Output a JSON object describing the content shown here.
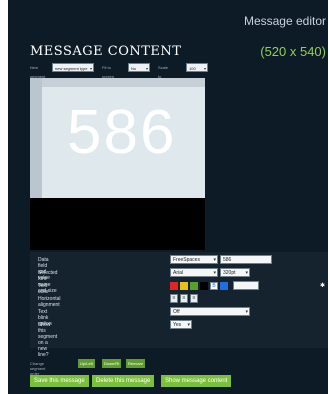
{
  "app_title": "Message editor",
  "message": {
    "title": "MESSAGE CONTENT",
    "size": "(520 x 540)"
  },
  "toolbar": {
    "new_segment_label": "New segment",
    "new_segment_value": "new segment type",
    "fit_to_screen_label": "Fit to screen",
    "fit_to_screen_value": "No",
    "scale_label": "Scale to screen",
    "scale_value": "100"
  },
  "display": {
    "text": "586"
  },
  "fields": {
    "data_field_label": "Data field and value",
    "data_field_select": "FreeSpaces",
    "data_field_value": "586",
    "font_label": "Selected font name and size",
    "font_name": "Arial",
    "font_size": "320pt",
    "text_color_label": "Text color",
    "color_code": "B",
    "horizontal_alignment_label": "Horizontal alignment",
    "blink_label": "Text blink option",
    "blink_value": "Off",
    "new_line_label": "Show this segment on a new line?",
    "new_line_value": "Yes"
  },
  "presets": {
    "label": "Change segment order",
    "buttons": [
      "Up/Left",
      "Down/Rt",
      "Remove"
    ]
  },
  "actions": {
    "save": "Save this message",
    "delete": "Delete this message",
    "show": "Show message content"
  },
  "colors": {
    "swatches": [
      "#e02525",
      "#e8c21a",
      "#5aa02c",
      "#000000",
      "#ffffff",
      "#1f6fe0"
    ]
  }
}
